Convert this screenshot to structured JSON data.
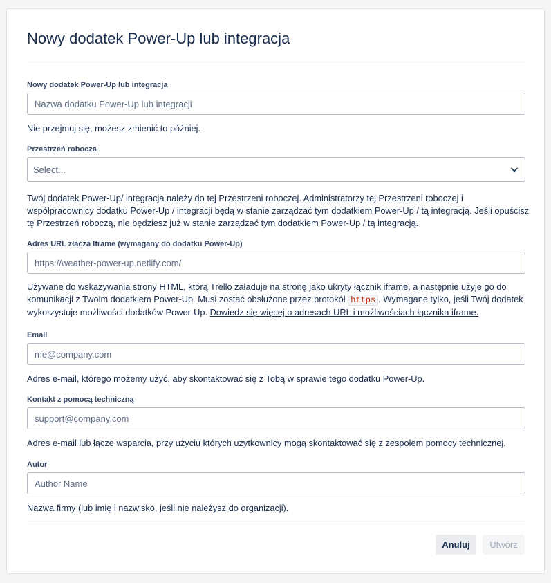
{
  "dialog": {
    "title": "Nowy dodatek Power-Up lub integracja"
  },
  "fields": {
    "name": {
      "label": "Nowy dodatek Power-Up lub integracja",
      "placeholder": "Nazwa dodatku Power-Up lub integracji",
      "value": "",
      "help": "Nie przejmuj się, możesz zmienić to później."
    },
    "workspace": {
      "label": "Przestrzeń robocza",
      "selected": "Select...",
      "help": "Twój dodatek Power-Up/ integracja należy do tej Przestrzeni roboczej. Administratorzy tej Przestrzeni roboczej i współpracownicy dodatku Power-Up / integracji będą w stanie zarządzać tym dodatkiem Power-Up / tą integracją. Jeśli opuścisz tę Przestrzeń roboczą, nie będziesz już w stanie zarządzać tym dodatkiem Power-Up / tą integracją."
    },
    "iframe_url": {
      "label": "Adres URL złącza Iframe (wymagany do dodatku Power-Up)",
      "placeholder": "https://weather-power-up.netlify.com/",
      "value": "",
      "help_before": "Używane do wskazywania strony HTML, którą Trello załaduje na stronę jako ukryty łącznik iframe, a następnie użyje go do komunikacji z Twoim dodatkiem Power-Up. Musi zostać obsłużone przez protokół ",
      "help_code": "https",
      "help_after": ". Wymagane tylko, jeśli Twój dodatek wykorzystuje możliwości dodatków Power-Up. ",
      "help_link": "Dowiedz się więcej o adresach URL i możliwościach łącznika iframe."
    },
    "email": {
      "label": "Email",
      "placeholder": "me@company.com",
      "value": "",
      "help": "Adres e-mail, którego możemy użyć, aby skontaktować się z Tobą w sprawie tego dodatku Power-Up."
    },
    "support": {
      "label": "Kontakt z pomocą techniczną",
      "placeholder": "support@company.com",
      "value": "",
      "help": "Adres e-mail lub łącze wsparcia, przy użyciu których użytkownicy mogą skontaktować się z zespołem pomocy technicznej."
    },
    "author": {
      "label": "Autor",
      "placeholder": "Author Name",
      "value": "",
      "help": "Nazwa firmy (lub imię i nazwisko, jeśli nie należysz do organizacji)."
    }
  },
  "actions": {
    "cancel_label": "Anuluj",
    "create_label": "Utwórz"
  },
  "icons": {
    "select_chevron": "chevron-down-icon"
  },
  "colors": {
    "text": "#172b4d",
    "border": "#b3bac5",
    "code_text": "#bf2600",
    "disabled_text": "#a5adba"
  }
}
